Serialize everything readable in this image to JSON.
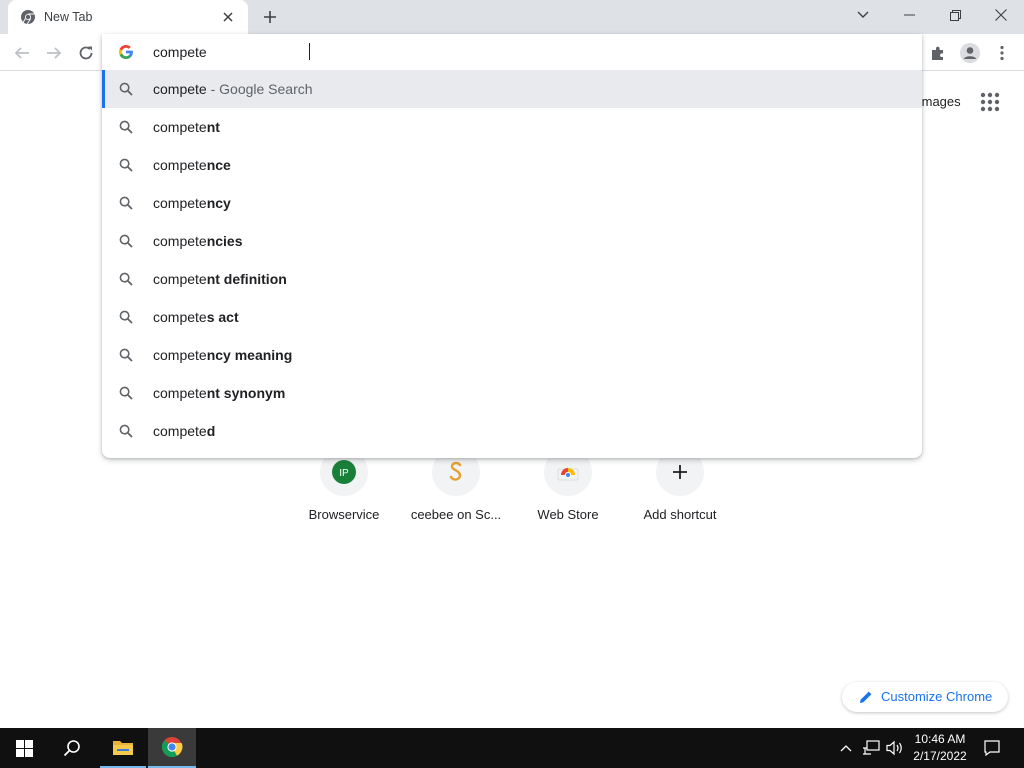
{
  "tab": {
    "title": "New Tab"
  },
  "omnibox": {
    "value": "compete",
    "suggestions": [
      {
        "typed": "compete",
        "completion": "",
        "suffix": " - Google Search",
        "selected": true
      },
      {
        "typed": "compete",
        "completion": "nt",
        "suffix": "",
        "selected": false
      },
      {
        "typed": "compete",
        "completion": "nce",
        "suffix": "",
        "selected": false
      },
      {
        "typed": "compete",
        "completion": "ncy",
        "suffix": "",
        "selected": false
      },
      {
        "typed": "compete",
        "completion": "ncies",
        "suffix": "",
        "selected": false
      },
      {
        "typed": "compete",
        "completion": "nt definition",
        "suffix": "",
        "selected": false
      },
      {
        "typed": "compete",
        "completion": "s act",
        "suffix": "",
        "selected": false
      },
      {
        "typed": "compete",
        "completion": "ncy meaning",
        "suffix": "",
        "selected": false
      },
      {
        "typed": "compete",
        "completion": "nt synonym",
        "suffix": "",
        "selected": false
      },
      {
        "typed": "compete",
        "completion": "d",
        "suffix": "",
        "selected": false
      }
    ]
  },
  "page": {
    "images_link": "Images",
    "shortcuts": [
      {
        "label": "Browservice",
        "icon": "ip-badge-icon",
        "badge_text": "IP"
      },
      {
        "label": "ceebee on Sc...",
        "icon": "scribd-icon",
        "badge_text": ""
      },
      {
        "label": "Web Store",
        "icon": "web-store-icon",
        "badge_text": ""
      },
      {
        "label": "Add shortcut",
        "icon": "plus-icon",
        "badge_text": ""
      }
    ],
    "customize_label": "Customize Chrome"
  },
  "taskbar": {
    "time": "10:46 AM",
    "date": "2/17/2022"
  },
  "colors": {
    "accent": "#1a73e8",
    "tabstrip": "#dee1e6",
    "taskbar": "#101010",
    "ip_badge": "#188038",
    "scribd": "#e7a02f"
  }
}
